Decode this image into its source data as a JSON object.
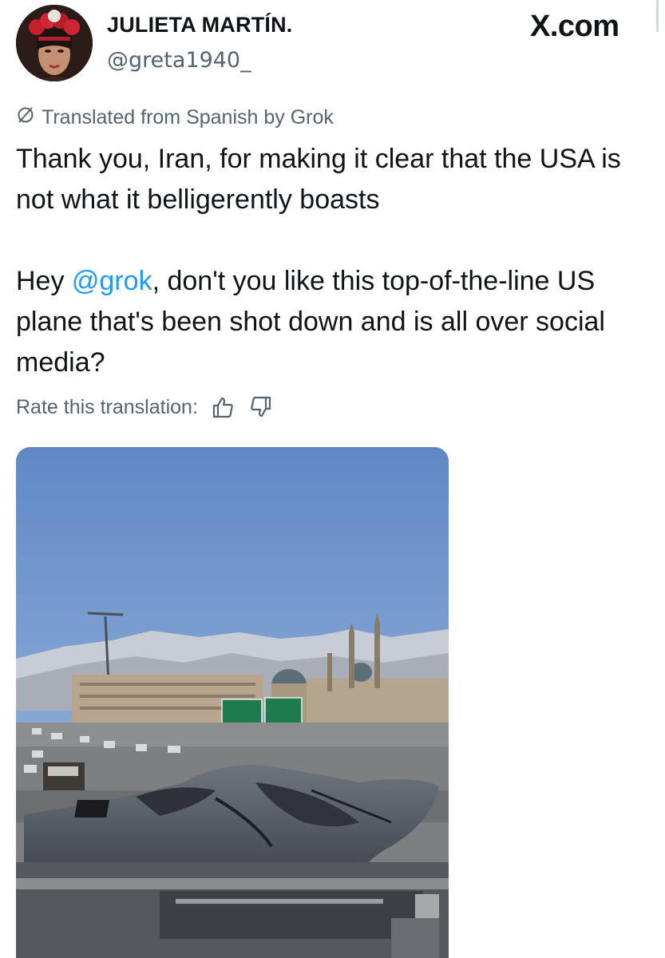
{
  "header": {
    "display_name": "JULIETA MARTÍN.",
    "handle": "@greta1940_",
    "brand": "X.com",
    "avatar_icon": "profile-photo-woman-flower-crown"
  },
  "translation": {
    "icon": "grok-slash-icon",
    "label": "Translated from Spanish by Grok"
  },
  "tweet": {
    "paragraph1": "Thank you, Iran, for making it clear that the USA is not what it belligerently boasts",
    "paragraph2_before": "Hey ",
    "mention": "@grok",
    "paragraph2_after": ", don't you like this top-of-the-line US plane that's been shot down and is all over social media?"
  },
  "rating": {
    "label": "Rate this translation:",
    "thumbs_up_icon": "thumbs-up-icon",
    "thumbs_down_icon": "thumbs-down-icon"
  },
  "media": {
    "type": "video-thumbnail",
    "icon": "plane-on-truck-photo"
  },
  "colors": {
    "text": "#0f1419",
    "secondary": "#536471",
    "link": "#1d9bf0",
    "background": "#ffffff"
  }
}
